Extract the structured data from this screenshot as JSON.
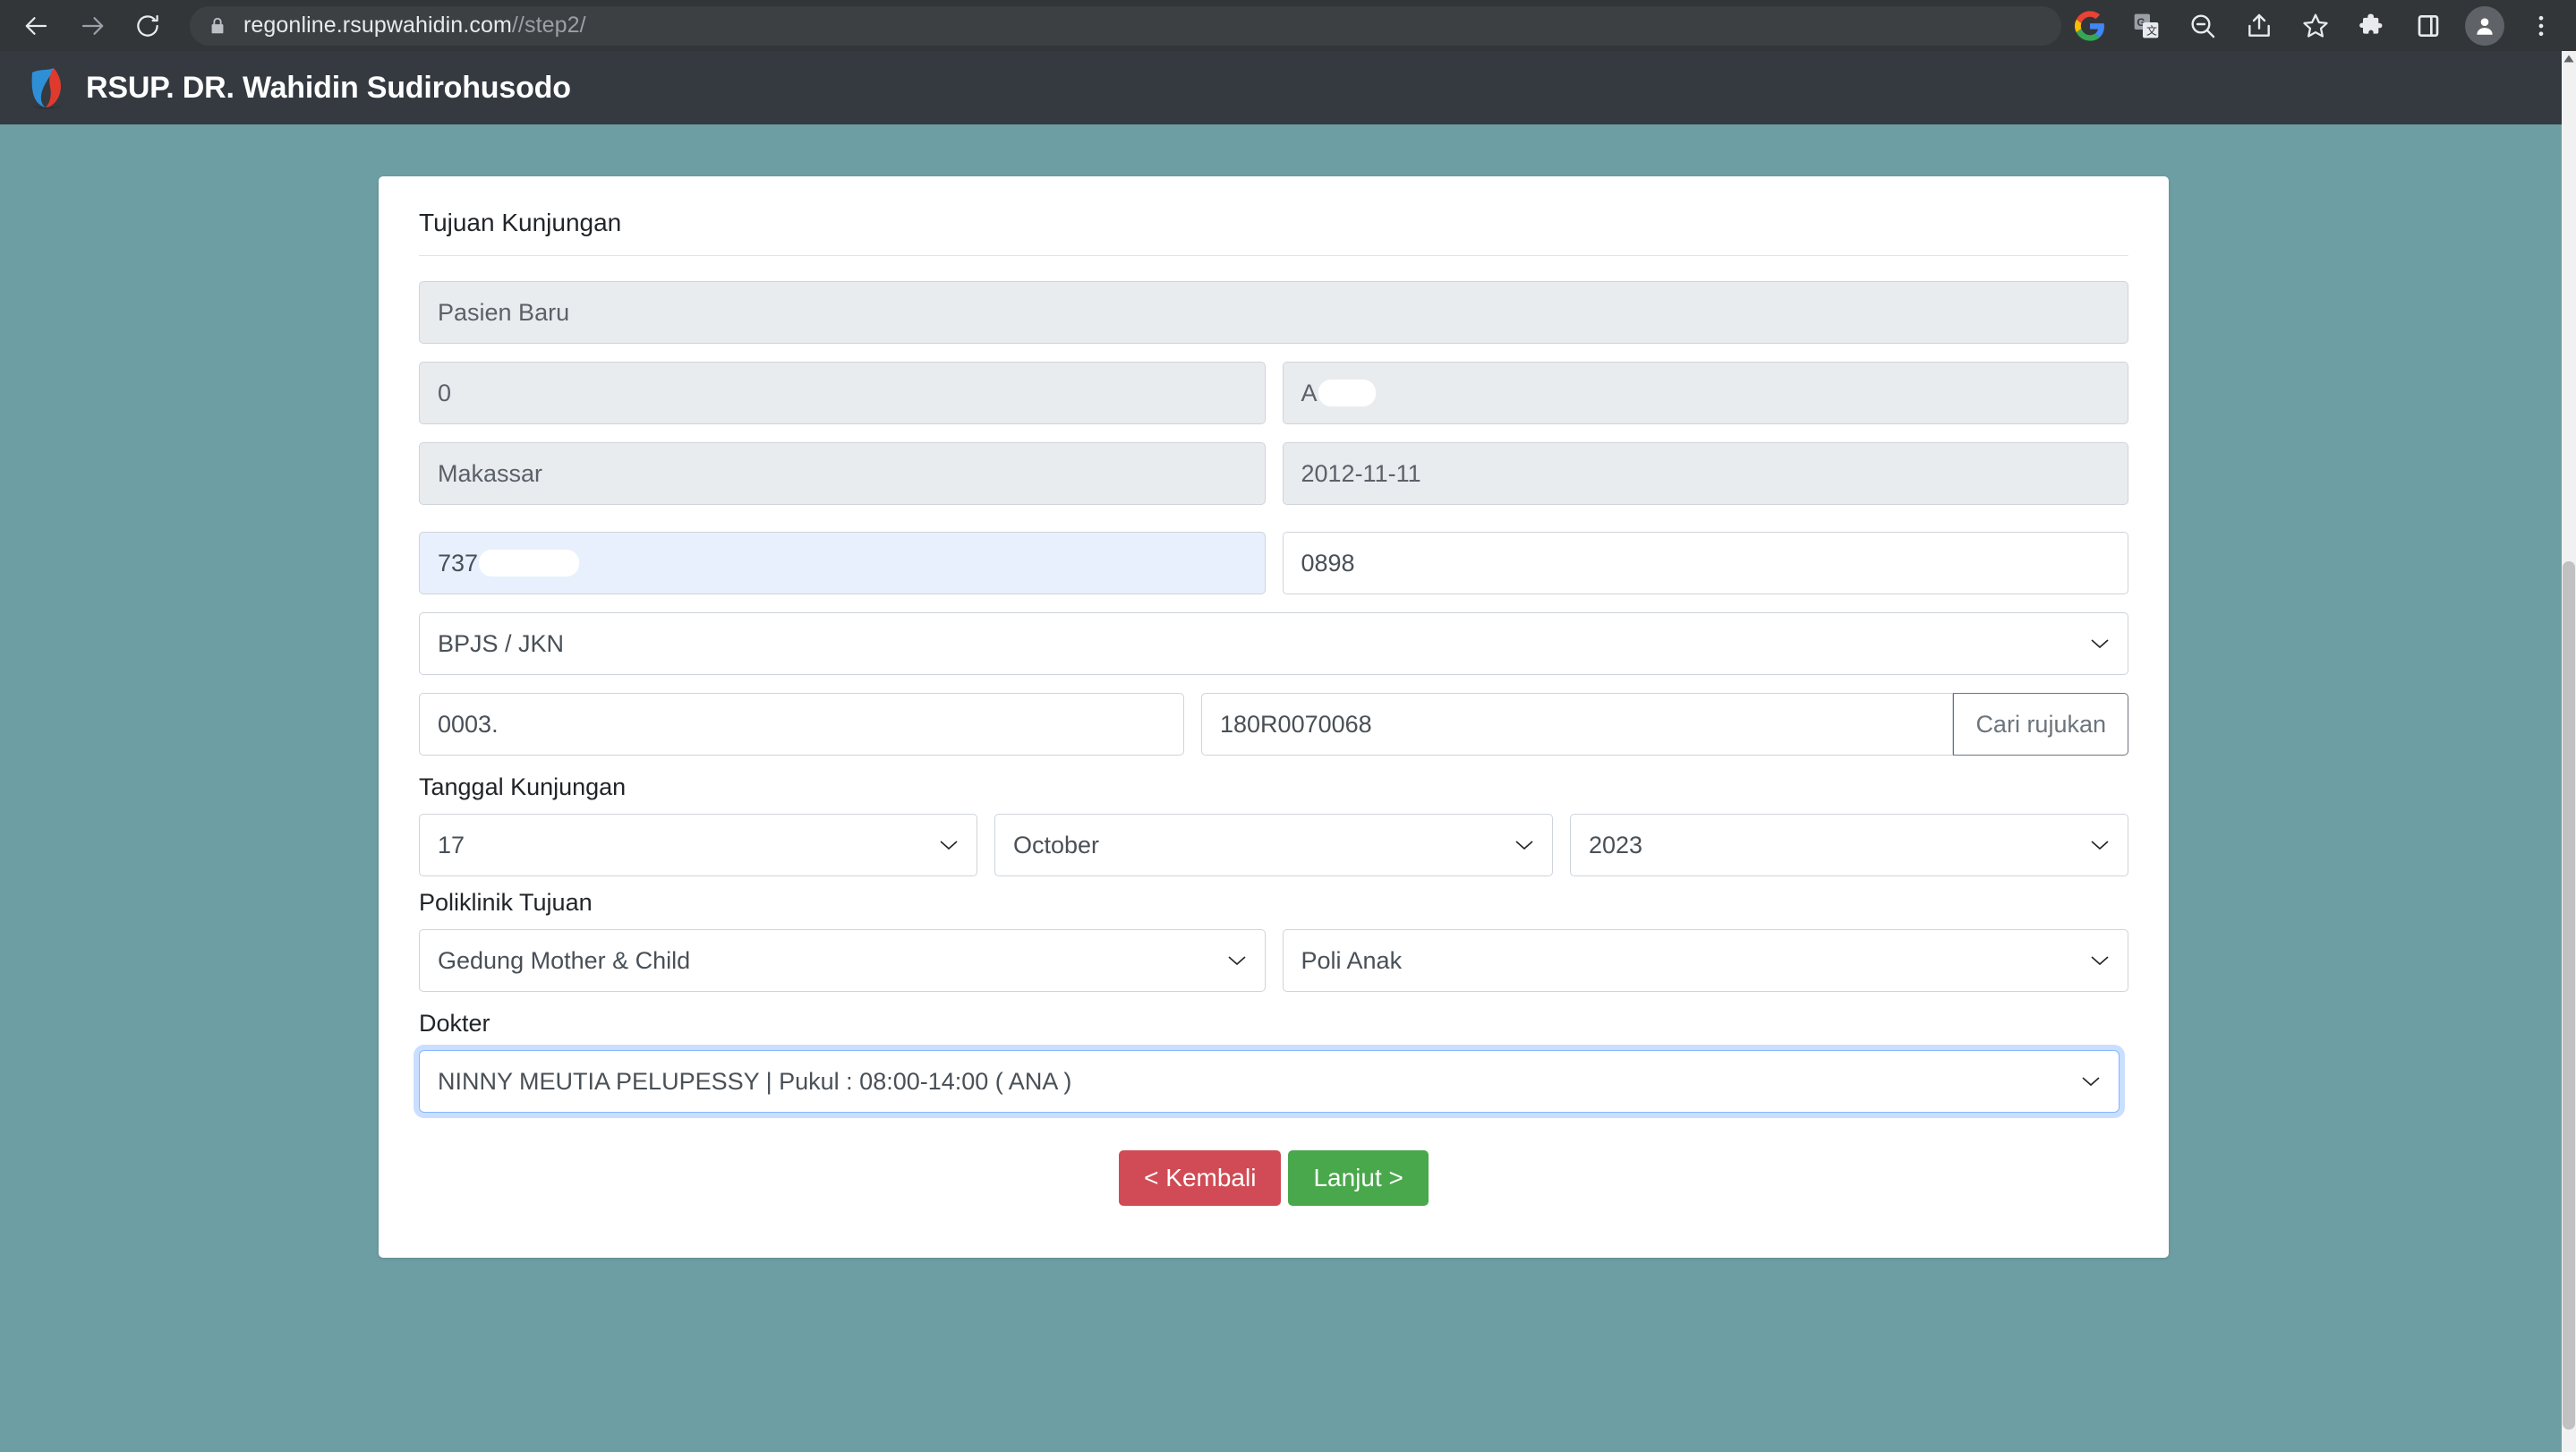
{
  "browser": {
    "back_icon": "arrow-left-icon",
    "forward_icon": "arrow-right-icon",
    "reload_icon": "reload-icon",
    "lock_icon": "lock-icon",
    "url_main": "regonline.rsupwahidin.com",
    "url_path": "//step2/",
    "right_icons": [
      {
        "name": "google-logo-icon"
      },
      {
        "name": "translate-icon"
      },
      {
        "name": "zoom-out-icon"
      },
      {
        "name": "share-icon"
      },
      {
        "name": "bookmark-star-icon"
      },
      {
        "name": "extensions-puzzle-icon"
      },
      {
        "name": "side-panel-icon"
      },
      {
        "name": "profile-avatar-icon"
      },
      {
        "name": "three-dot-menu-icon"
      }
    ]
  },
  "site_header": {
    "logo": "hospital-shield-logo",
    "title": "RSUP. DR. Wahidin Sudirohusodo",
    "background": "#343a40"
  },
  "theme": {
    "page_background": "#6d9ea3",
    "card_background": "#ffffff",
    "back_button_color": "#d04b55",
    "next_button_color": "#49a84c",
    "autofill_color": "#e8f0fe",
    "focus_ring_color": "#86b7fe"
  },
  "form": {
    "section_title": "Tujuan Kunjungan",
    "patient_type": "Pasien Baru",
    "medical_record_no": "0",
    "patient_name": "A",
    "birth_place": "Makassar",
    "birth_date": "2012-11-11",
    "nik": "737",
    "phone": "0898",
    "insurance": "BPJS / JKN",
    "referral_code": "0003.",
    "referral_number": "180R0070068",
    "search_referral_label": "Cari rujukan",
    "visit_date_label": "Tanggal Kunjungan",
    "visit_day": "17",
    "visit_month": "October",
    "visit_year": "2023",
    "clinic_label": "Poliklinik Tujuan",
    "clinic_building": "Gedung Mother & Child",
    "clinic_unit": "Poli Anak",
    "doctor_label": "Dokter",
    "doctor_value": "NINNY MEUTIA PELUPESSY | Pukul : 08:00-14:00 ( ANA )",
    "back_label": "< Kembali",
    "next_label": "Lanjut >"
  }
}
